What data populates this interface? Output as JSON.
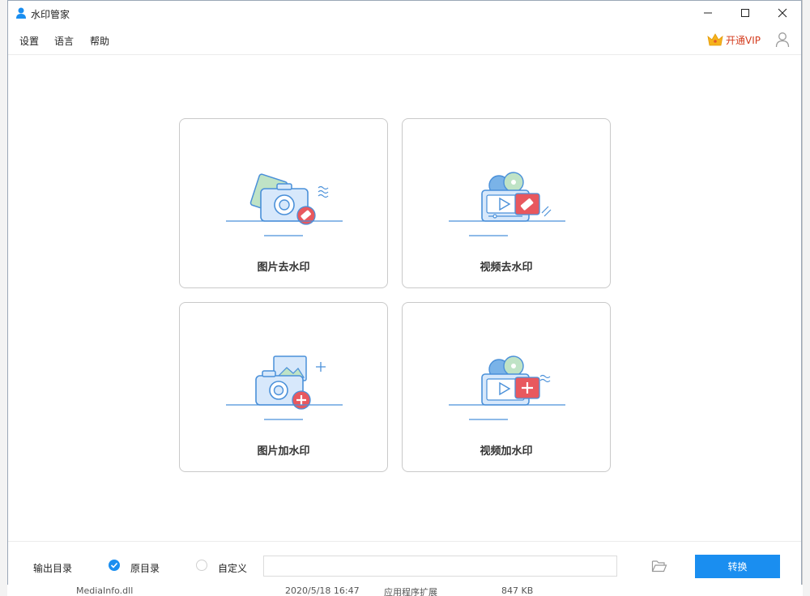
{
  "window": {
    "title": "水印管家"
  },
  "menu": {
    "settings": "设置",
    "language": "语言",
    "help": "帮助",
    "vip": "开通VIP"
  },
  "cards": [
    {
      "label": "图片去水印"
    },
    {
      "label": "视频去水印"
    },
    {
      "label": "图片加水印"
    },
    {
      "label": "视频加水印"
    }
  ],
  "footer": {
    "output_label": "输出目录",
    "option_original": "原目录",
    "option_custom": "自定义",
    "path_value": "",
    "convert": "转换",
    "selected_option": "原目录"
  },
  "background": {
    "file_name": "MediaInfo.dll",
    "file_date": "2020/5/18 16:47",
    "file_type": "应用程序扩展",
    "file_size": "847 KB"
  },
  "colors": {
    "accent": "#1a8ef0",
    "vip": "#d43c1e",
    "icon_blue": "#4a90d9",
    "icon_red": "#e8585e",
    "icon_green": "#9fd6a8"
  }
}
